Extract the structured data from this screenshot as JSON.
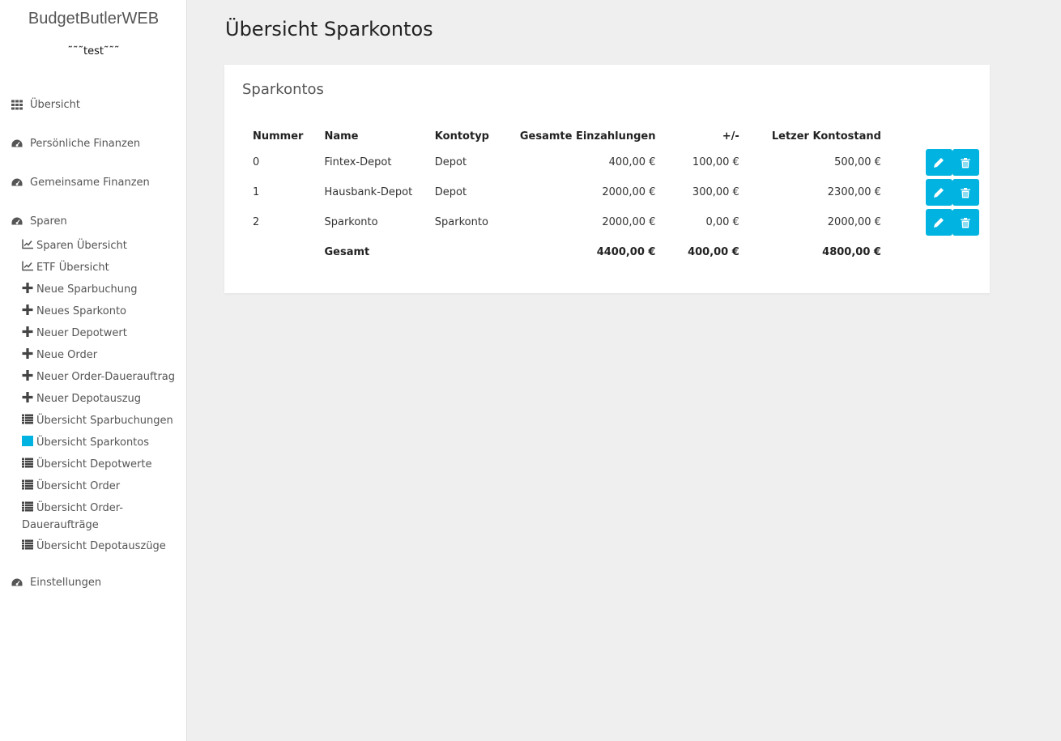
{
  "app": {
    "brand": "BudgetButlerWEB",
    "user": "˜˜˜test˜˜˜"
  },
  "sidebar": {
    "top_items": [
      {
        "label": "Übersicht",
        "icon": "grid-icon"
      },
      {
        "label": "Persönliche Finanzen",
        "icon": "dashboard-icon"
      },
      {
        "label": "Gemeinsame Finanzen",
        "icon": "dashboard-icon"
      },
      {
        "label": "Sparen",
        "icon": "dashboard-icon"
      },
      {
        "label": "Einstellungen",
        "icon": "dashboard-icon"
      }
    ],
    "sparen_items": [
      {
        "label": "Sparen Übersicht",
        "icon": "line-chart-icon"
      },
      {
        "label": "ETF Übersicht",
        "icon": "line-chart-icon"
      },
      {
        "label": "Neue Sparbuchung",
        "icon": "plus-icon"
      },
      {
        "label": "Neues Sparkonto",
        "icon": "plus-icon"
      },
      {
        "label": "Neuer Depotwert",
        "icon": "plus-icon"
      },
      {
        "label": "Neue Order",
        "icon": "plus-icon"
      },
      {
        "label": "Neuer Order-Dauerauftrag",
        "icon": "plus-icon"
      },
      {
        "label": "Neuer Depotauszug",
        "icon": "plus-icon"
      },
      {
        "label": "Übersicht Sparbuchungen",
        "icon": "list-icon"
      },
      {
        "label": "Übersicht Sparkontos",
        "icon": "list-icon",
        "active": true
      },
      {
        "label": "Übersicht Depotwerte",
        "icon": "list-icon"
      },
      {
        "label": "Übersicht Order",
        "icon": "list-icon"
      },
      {
        "label": "Übersicht Order-Daueraufträge",
        "icon": "list-icon"
      },
      {
        "label": "Übersicht Depotauszüge",
        "icon": "list-icon"
      }
    ],
    "active_color": "#00b3e0"
  },
  "main": {
    "page_title": "Übersicht Sparkontos",
    "panel_title": "Sparkontos",
    "table": {
      "headers": [
        "Nummer",
        "Name",
        "Kontotyp",
        "Gesamte Einzahlungen",
        "+/-",
        "Letzer Kontostand"
      ],
      "rows": [
        [
          "0",
          "Fintex-Depot",
          "Depot",
          "400,00 €",
          "100,00 €",
          "500,00 €"
        ],
        [
          "1",
          "Hausbank-Depot",
          "Depot",
          "2000,00 €",
          "300,00 €",
          "2300,00 €"
        ],
        [
          "2",
          "Sparkonto",
          "Sparkonto",
          "2000,00 €",
          "0,00 €",
          "2000,00 €"
        ]
      ],
      "total": [
        "",
        "Gesamt",
        "",
        "4400,00 €",
        "400,00 €",
        "4800,00 €"
      ]
    },
    "button_color": "#00b3e0"
  }
}
